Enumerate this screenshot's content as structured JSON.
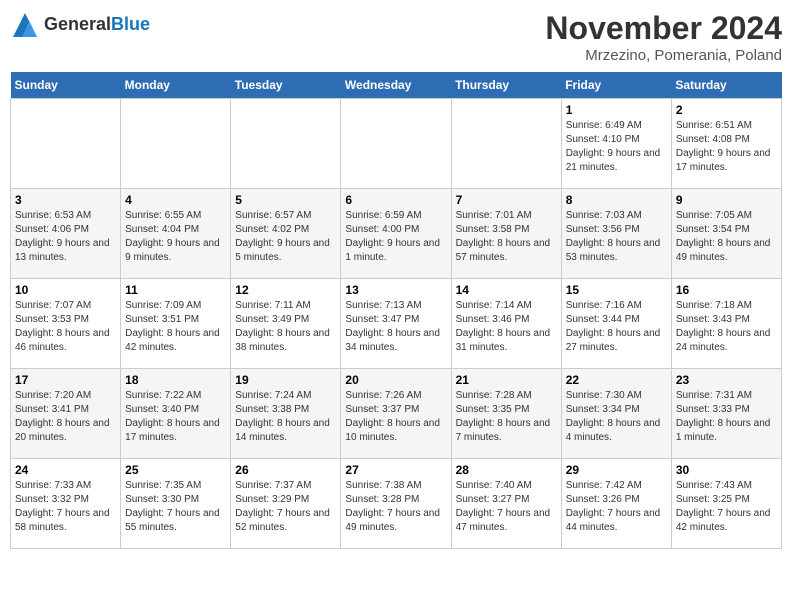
{
  "logo": {
    "general": "General",
    "blue": "Blue"
  },
  "title": "November 2024",
  "location": "Mrzezino, Pomerania, Poland",
  "days_of_week": [
    "Sunday",
    "Monday",
    "Tuesday",
    "Wednesday",
    "Thursday",
    "Friday",
    "Saturday"
  ],
  "weeks": [
    [
      {
        "day": "",
        "info": ""
      },
      {
        "day": "",
        "info": ""
      },
      {
        "day": "",
        "info": ""
      },
      {
        "day": "",
        "info": ""
      },
      {
        "day": "",
        "info": ""
      },
      {
        "day": "1",
        "info": "Sunrise: 6:49 AM\nSunset: 4:10 PM\nDaylight: 9 hours and 21 minutes."
      },
      {
        "day": "2",
        "info": "Sunrise: 6:51 AM\nSunset: 4:08 PM\nDaylight: 9 hours and 17 minutes."
      }
    ],
    [
      {
        "day": "3",
        "info": "Sunrise: 6:53 AM\nSunset: 4:06 PM\nDaylight: 9 hours and 13 minutes."
      },
      {
        "day": "4",
        "info": "Sunrise: 6:55 AM\nSunset: 4:04 PM\nDaylight: 9 hours and 9 minutes."
      },
      {
        "day": "5",
        "info": "Sunrise: 6:57 AM\nSunset: 4:02 PM\nDaylight: 9 hours and 5 minutes."
      },
      {
        "day": "6",
        "info": "Sunrise: 6:59 AM\nSunset: 4:00 PM\nDaylight: 9 hours and 1 minute."
      },
      {
        "day": "7",
        "info": "Sunrise: 7:01 AM\nSunset: 3:58 PM\nDaylight: 8 hours and 57 minutes."
      },
      {
        "day": "8",
        "info": "Sunrise: 7:03 AM\nSunset: 3:56 PM\nDaylight: 8 hours and 53 minutes."
      },
      {
        "day": "9",
        "info": "Sunrise: 7:05 AM\nSunset: 3:54 PM\nDaylight: 8 hours and 49 minutes."
      }
    ],
    [
      {
        "day": "10",
        "info": "Sunrise: 7:07 AM\nSunset: 3:53 PM\nDaylight: 8 hours and 46 minutes."
      },
      {
        "day": "11",
        "info": "Sunrise: 7:09 AM\nSunset: 3:51 PM\nDaylight: 8 hours and 42 minutes."
      },
      {
        "day": "12",
        "info": "Sunrise: 7:11 AM\nSunset: 3:49 PM\nDaylight: 8 hours and 38 minutes."
      },
      {
        "day": "13",
        "info": "Sunrise: 7:13 AM\nSunset: 3:47 PM\nDaylight: 8 hours and 34 minutes."
      },
      {
        "day": "14",
        "info": "Sunrise: 7:14 AM\nSunset: 3:46 PM\nDaylight: 8 hours and 31 minutes."
      },
      {
        "day": "15",
        "info": "Sunrise: 7:16 AM\nSunset: 3:44 PM\nDaylight: 8 hours and 27 minutes."
      },
      {
        "day": "16",
        "info": "Sunrise: 7:18 AM\nSunset: 3:43 PM\nDaylight: 8 hours and 24 minutes."
      }
    ],
    [
      {
        "day": "17",
        "info": "Sunrise: 7:20 AM\nSunset: 3:41 PM\nDaylight: 8 hours and 20 minutes."
      },
      {
        "day": "18",
        "info": "Sunrise: 7:22 AM\nSunset: 3:40 PM\nDaylight: 8 hours and 17 minutes."
      },
      {
        "day": "19",
        "info": "Sunrise: 7:24 AM\nSunset: 3:38 PM\nDaylight: 8 hours and 14 minutes."
      },
      {
        "day": "20",
        "info": "Sunrise: 7:26 AM\nSunset: 3:37 PM\nDaylight: 8 hours and 10 minutes."
      },
      {
        "day": "21",
        "info": "Sunrise: 7:28 AM\nSunset: 3:35 PM\nDaylight: 8 hours and 7 minutes."
      },
      {
        "day": "22",
        "info": "Sunrise: 7:30 AM\nSunset: 3:34 PM\nDaylight: 8 hours and 4 minutes."
      },
      {
        "day": "23",
        "info": "Sunrise: 7:31 AM\nSunset: 3:33 PM\nDaylight: 8 hours and 1 minute."
      }
    ],
    [
      {
        "day": "24",
        "info": "Sunrise: 7:33 AM\nSunset: 3:32 PM\nDaylight: 7 hours and 58 minutes."
      },
      {
        "day": "25",
        "info": "Sunrise: 7:35 AM\nSunset: 3:30 PM\nDaylight: 7 hours and 55 minutes."
      },
      {
        "day": "26",
        "info": "Sunrise: 7:37 AM\nSunset: 3:29 PM\nDaylight: 7 hours and 52 minutes."
      },
      {
        "day": "27",
        "info": "Sunrise: 7:38 AM\nSunset: 3:28 PM\nDaylight: 7 hours and 49 minutes."
      },
      {
        "day": "28",
        "info": "Sunrise: 7:40 AM\nSunset: 3:27 PM\nDaylight: 7 hours and 47 minutes."
      },
      {
        "day": "29",
        "info": "Sunrise: 7:42 AM\nSunset: 3:26 PM\nDaylight: 7 hours and 44 minutes."
      },
      {
        "day": "30",
        "info": "Sunrise: 7:43 AM\nSunset: 3:25 PM\nDaylight: 7 hours and 42 minutes."
      }
    ]
  ]
}
